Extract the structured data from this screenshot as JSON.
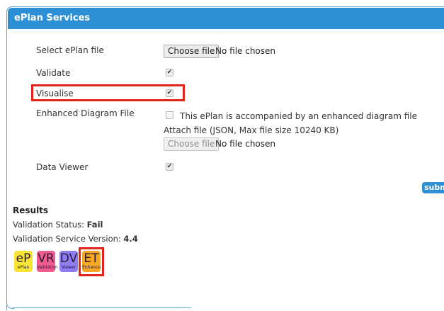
{
  "panel": {
    "title": "ePlan Services",
    "header_color": "#2d8fd5",
    "highlight_color": "#e2231a"
  },
  "form": {
    "select_file": {
      "label": "Select ePlan file",
      "button": "Choose file",
      "status": "No file chosen"
    },
    "validate": {
      "label": "Validate",
      "checked": true
    },
    "visualise": {
      "label": "Visualise",
      "checked": true
    },
    "enhanced": {
      "label": "Enhanced Diagram File",
      "checkbox_text": "This ePlan is accompanied by an enhanced diagram file",
      "checked": false,
      "attach_text": "Attach file (JSON, Max file size 10240 KB)",
      "button": "Choose file",
      "status": "No file chosen"
    },
    "data_viewer": {
      "label": "Data Viewer",
      "checked": true
    },
    "submit_label": "submit"
  },
  "results": {
    "heading": "Results",
    "status_label": "Validation Status:",
    "status_value": "Fail",
    "version_label": "Validation Service Version:",
    "version_value": "4.4"
  },
  "apps": [
    {
      "abbr": "eP",
      "name": "ePlan",
      "color": "#f7e437",
      "icon": "eplan-app-icon"
    },
    {
      "abbr": "VR",
      "name": "Validation",
      "color": "#ef5c8e",
      "icon": "validation-report-app-icon"
    },
    {
      "abbr": "DV",
      "name": "Viewer",
      "color": "#8e7cf0",
      "icon": "data-viewer-app-icon"
    },
    {
      "abbr": "ET",
      "name": "Enhance",
      "color": "#f5a623",
      "icon": "enhance-tool-app-icon"
    }
  ]
}
